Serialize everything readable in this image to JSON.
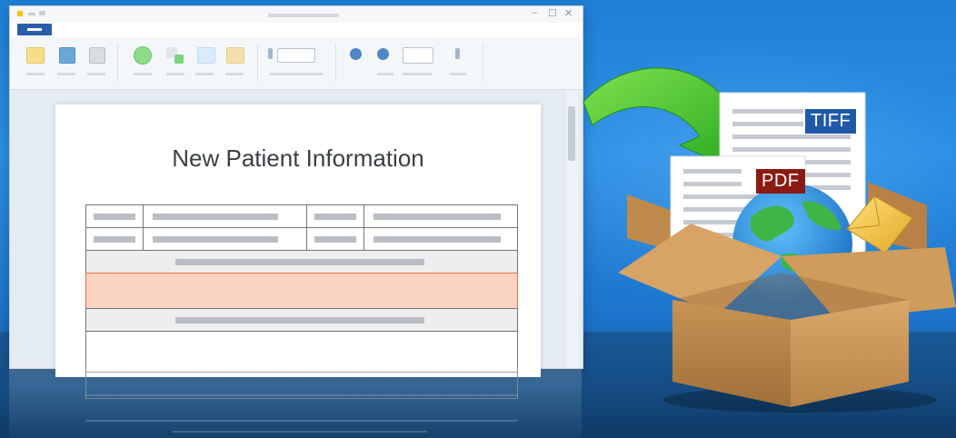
{
  "document": {
    "title": "New Patient Information"
  },
  "formats": {
    "tiff_label": "TIFF",
    "pdf_label": "PDF"
  },
  "colors": {
    "background": "#2a8fe4",
    "tiff_badge": "#1f5aa8",
    "pdf_badge": "#8b1a12",
    "arrow": "#45c82a",
    "highlight_row": "#fbd3c2",
    "file_tab": "#2a5ea8"
  },
  "icons": [
    "arrow-icon",
    "document-icon",
    "globe-icon",
    "envelope-icon",
    "box-icon"
  ]
}
